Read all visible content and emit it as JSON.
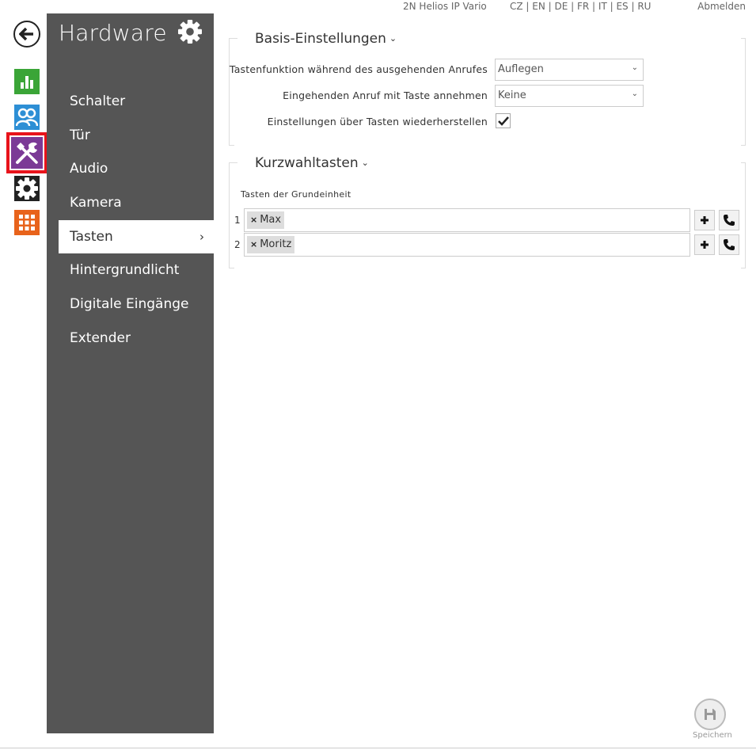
{
  "topbar": {
    "device": "2N Helios IP Vario",
    "languages": "CZ | EN | DE | FR | IT | ES | RU",
    "logout": "Abmelden"
  },
  "rail": {
    "back_icon": "arrow-left-icon",
    "items": [
      {
        "name": "status",
        "icon": "bar-chart-icon",
        "color": "#3aa537"
      },
      {
        "name": "directory",
        "icon": "users-icon",
        "color": "#2d8fd5"
      },
      {
        "name": "hardware",
        "icon": "tools-icon",
        "color": "#7b3a96",
        "active": true
      },
      {
        "name": "system",
        "icon": "gear-icon",
        "color": "#222222"
      },
      {
        "name": "services",
        "icon": "grid-icon",
        "color": "#e8631b"
      }
    ]
  },
  "sidebar": {
    "title": "Hardware",
    "items": [
      {
        "label": "Schalter"
      },
      {
        "label": "Tür"
      },
      {
        "label": "Audio"
      },
      {
        "label": "Kamera"
      },
      {
        "label": "Tasten",
        "active": true
      },
      {
        "label": "Hintergrundlicht"
      },
      {
        "label": "Digitale Eingänge"
      },
      {
        "label": "Extender"
      }
    ]
  },
  "basis": {
    "title": "Basis-Einstellungen",
    "rows": [
      {
        "label": "Tastenfunktion während des ausgehenden Anrufes",
        "value": "Auflegen"
      },
      {
        "label": "Eingehenden Anruf mit Taste annehmen",
        "value": "Keine"
      },
      {
        "label": "Einstellungen über Tasten wiederherstellen",
        "checked": true
      }
    ]
  },
  "kurzwahl": {
    "title": "Kurzwahltasten",
    "subhead": "Tasten der Grundeinheit",
    "keys": [
      {
        "number": "1",
        "tag": "Max"
      },
      {
        "number": "2",
        "tag": "Moritz"
      }
    ]
  },
  "save": {
    "label": "Speichern"
  },
  "colors": {
    "accent_red": "#e8131b",
    "panel": "#555555"
  }
}
